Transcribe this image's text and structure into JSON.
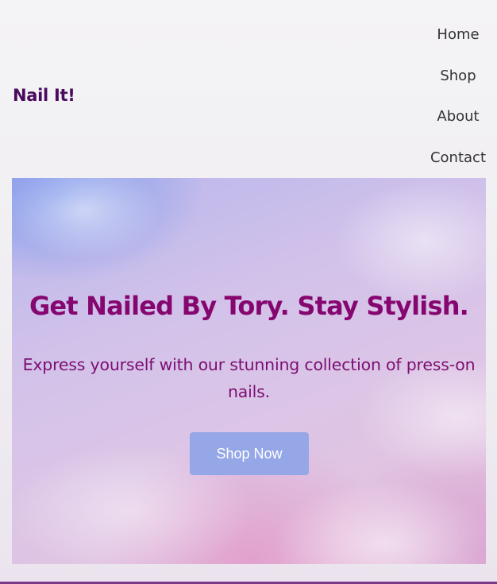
{
  "brand": {
    "name": "Nail It!"
  },
  "nav": {
    "items": [
      {
        "label": "Home"
      },
      {
        "label": "Shop"
      },
      {
        "label": "About"
      },
      {
        "label": "Contact"
      }
    ]
  },
  "hero": {
    "title": "Get Nailed By Tory. Stay Stylish.",
    "subtitle": "Express yourself with our stunning collection of press-on nails.",
    "cta_label": "Shop Now"
  },
  "colors": {
    "brand": "#4a0a5e",
    "hero_title": "#86066f",
    "cta_background": "#95a7e6"
  }
}
